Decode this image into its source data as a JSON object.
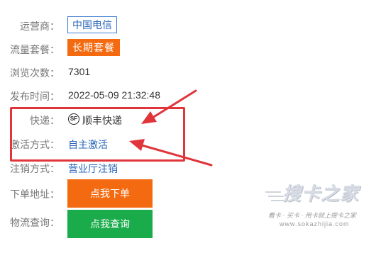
{
  "rows": {
    "carrier": {
      "label": "运营商",
      "value": "中国电信"
    },
    "plan": {
      "label": "流量套餐",
      "value": "长期套餐"
    },
    "views": {
      "label": "浏览次数",
      "value": "7301"
    },
    "published": {
      "label": "发布时间",
      "value": "2022-05-09 21:32:48"
    },
    "express": {
      "label": "快递",
      "icon_text": "SF",
      "value": "顺丰快递"
    },
    "activation": {
      "label": "激活方式",
      "value": "自主激活"
    },
    "cancel": {
      "label": "注销方式",
      "value": "营业厅注销"
    },
    "order": {
      "label": "下单地址",
      "button": "点我下单"
    },
    "logistics": {
      "label": "物流查询",
      "button": "点我查询"
    }
  },
  "colon": "：",
  "watermark": {
    "name": "搜卡之家",
    "slogan": "看卡 · 买卡 · 用卡就上搜卡之家",
    "url": "www.sokazhijia.com"
  },
  "colors": {
    "accent_orange": "#f36a10",
    "accent_green": "#1aab4a",
    "link_blue": "#2a66b8",
    "highlight_red": "#e0353a"
  }
}
